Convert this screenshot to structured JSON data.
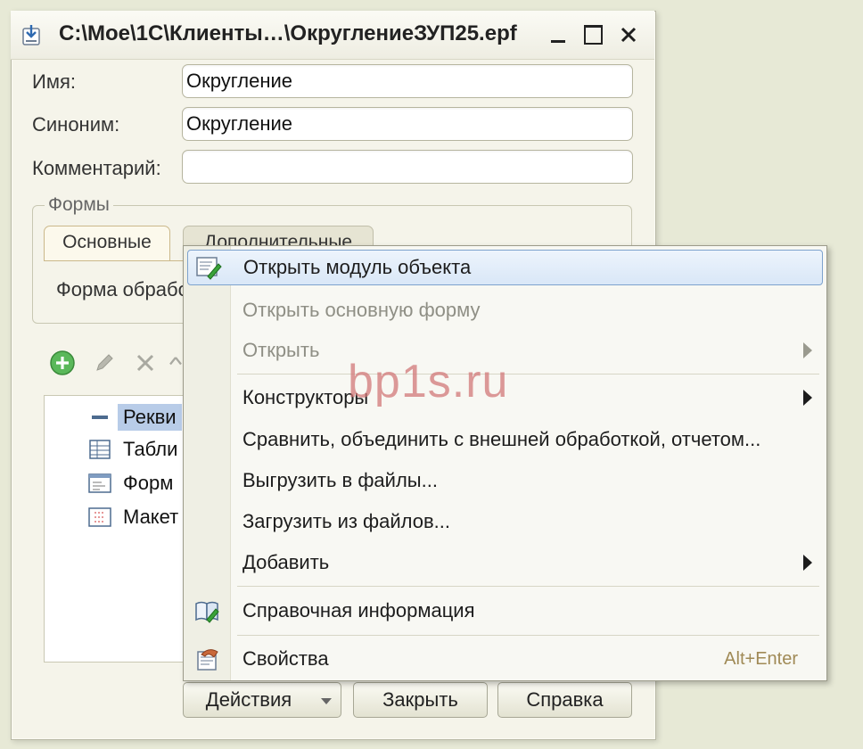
{
  "window": {
    "title": "C:\\Мое\\1С\\Клиенты…\\ОкруглениеЗУП25.epf"
  },
  "fields": {
    "name_label": "Имя:",
    "name_value": "Округление",
    "synonym_label": "Синоним:",
    "synonym_value": "Округление",
    "comment_label": "Комментарий:",
    "comment_value": ""
  },
  "forms_group": {
    "legend": "Формы",
    "tabs": [
      {
        "label": "Основные"
      },
      {
        "label": "Дополнительные"
      }
    ],
    "form_label": "Форма обрабо"
  },
  "tree": {
    "items": [
      {
        "label": "Рекви",
        "icon": "attribute-icon"
      },
      {
        "label": "Табли",
        "icon": "table-icon"
      },
      {
        "label": "Форм",
        "icon": "form-icon"
      },
      {
        "label": "Макет",
        "icon": "template-icon"
      }
    ]
  },
  "buttons": {
    "actions": "Действия",
    "close": "Закрыть",
    "help": "Справка"
  },
  "menu": {
    "items": [
      {
        "label": "Открыть модуль объекта",
        "icon": "module-icon"
      },
      {
        "label": "Открыть основную форму"
      },
      {
        "label": "Открыть"
      },
      {
        "label": "Конструкторы"
      },
      {
        "label": "Сравнить, объединить с внешней обработкой, отчетом..."
      },
      {
        "label": "Выгрузить в файлы..."
      },
      {
        "label": "Загрузить из файлов..."
      },
      {
        "label": "Добавить"
      },
      {
        "label": "Справочная информация",
        "icon": "help-book-icon"
      },
      {
        "label": "Свойства",
        "icon": "properties-icon",
        "shortcut": "Alt+Enter"
      }
    ]
  },
  "watermark": "bp1s.ru",
  "colors": {
    "highlight_border": "#7da2ce",
    "selection": "#b8cce8",
    "watermark": "#d27878"
  }
}
